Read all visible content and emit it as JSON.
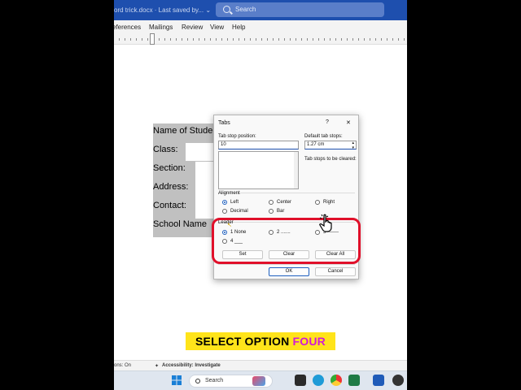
{
  "titlebar": {
    "doc_title": "ord trick.docx  ·  Last saved by...  ⌄",
    "search_placeholder": "Search"
  },
  "ribbon": {
    "tabs": [
      "eferences",
      "Mailings",
      "Review",
      "View",
      "Help"
    ]
  },
  "document": {
    "lines": [
      "Name of Stude",
      "Class:",
      "Section:",
      "Address:",
      "Contact:",
      "School Name"
    ]
  },
  "dialog": {
    "title": "Tabs",
    "help": "?",
    "close": "✕",
    "tab_stop_position_label": "Tab stop position:",
    "tab_stop_position_value": "10",
    "default_tab_stops_label": "Default tab stops:",
    "default_tab_stops_value": "1.27 cm",
    "tab_stops_cleared_label": "Tab stops to be cleared:",
    "alignment_label": "Alignment",
    "alignment_options": [
      "Left",
      "Center",
      "Right",
      "Decimal",
      "Bar"
    ],
    "alignment_selected": "Left",
    "leader_label": "Leader",
    "leader_options": [
      "1 None",
      "2 .......",
      "3 -------",
      "4 ___"
    ],
    "leader_selected": "1 None",
    "buttons": {
      "set": "Set",
      "clear": "Clear",
      "clear_all": "Clear All",
      "ok": "OK",
      "cancel": "Cancel"
    }
  },
  "caption": {
    "text_main": "SELECT OPTION ",
    "text_highlight": "FOUR"
  },
  "statusbar": {
    "left": "ons: On",
    "accessibility": "Accessibility: Investigate"
  },
  "taskbar": {
    "search_placeholder": "Search"
  },
  "colors": {
    "title_blue": "#1e4fae",
    "highlight_red": "#e0102a",
    "caption_yellow": "#ffe41a",
    "caption_magenta": "#d11ad6"
  }
}
